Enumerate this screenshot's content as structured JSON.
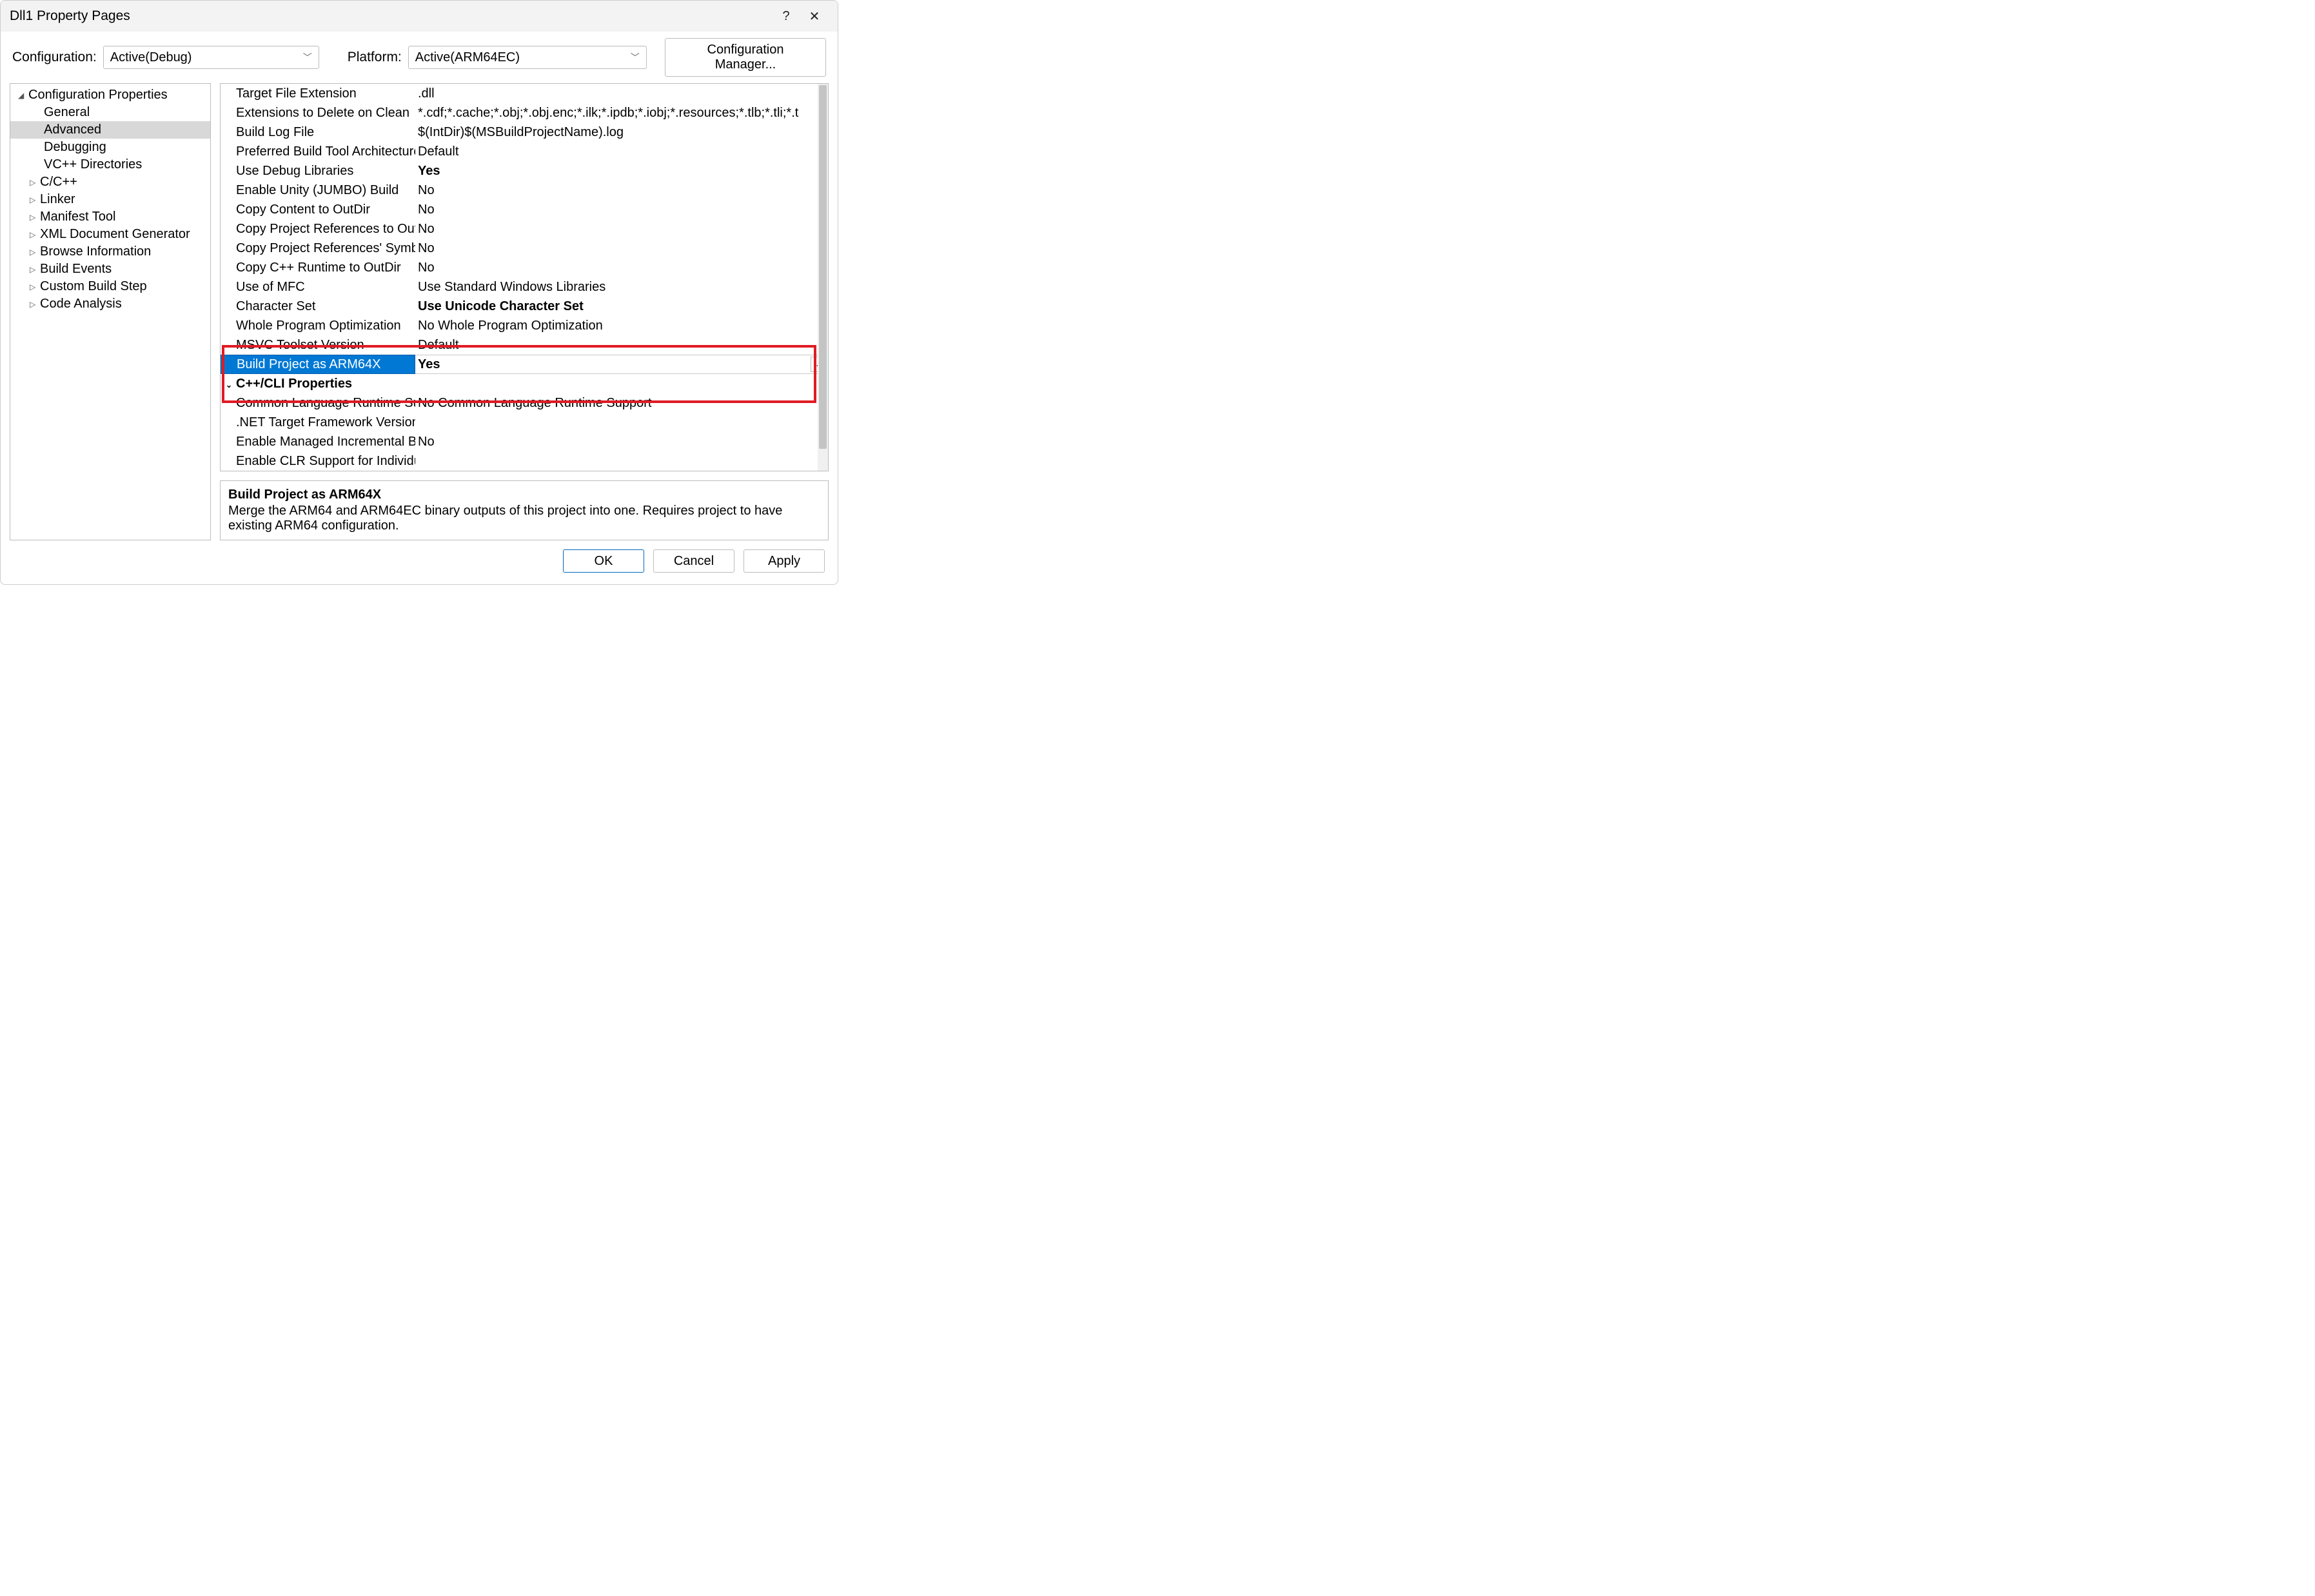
{
  "title": "Dll1 Property Pages",
  "toolbar": {
    "config_label": "Configuration:",
    "config_value": "Active(Debug)",
    "platform_label": "Platform:",
    "platform_value": "Active(ARM64EC)",
    "config_manager": "Configuration Manager..."
  },
  "tree": {
    "root": "Configuration Properties",
    "items": [
      {
        "label": "General",
        "expander": ""
      },
      {
        "label": "Advanced",
        "expander": "",
        "selected": true
      },
      {
        "label": "Debugging",
        "expander": ""
      },
      {
        "label": "VC++ Directories",
        "expander": ""
      },
      {
        "label": "C/C++",
        "expander": "▷"
      },
      {
        "label": "Linker",
        "expander": "▷"
      },
      {
        "label": "Manifest Tool",
        "expander": "▷"
      },
      {
        "label": "XML Document Generator",
        "expander": "▷"
      },
      {
        "label": "Browse Information",
        "expander": "▷"
      },
      {
        "label": "Build Events",
        "expander": "▷"
      },
      {
        "label": "Custom Build Step",
        "expander": "▷"
      },
      {
        "label": "Code Analysis",
        "expander": "▷"
      }
    ]
  },
  "grid": [
    {
      "k": "Target File Extension",
      "v": ".dll"
    },
    {
      "k": "Extensions to Delete on Clean",
      "v": "*.cdf;*.cache;*.obj;*.obj.enc;*.ilk;*.ipdb;*.iobj;*.resources;*.tlb;*.tli;*.t"
    },
    {
      "k": "Build Log File",
      "v": "$(IntDir)$(MSBuildProjectName).log"
    },
    {
      "k": "Preferred Build Tool Architecture",
      "v": "Default"
    },
    {
      "k": "Use Debug Libraries",
      "v": "Yes",
      "bold": true
    },
    {
      "k": "Enable Unity (JUMBO) Build",
      "v": "No"
    },
    {
      "k": "Copy Content to OutDir",
      "v": "No"
    },
    {
      "k": "Copy Project References to OutDi",
      "v": "No"
    },
    {
      "k": "Copy Project References' Symbols",
      "v": "No"
    },
    {
      "k": "Copy C++ Runtime to OutDir",
      "v": "No"
    },
    {
      "k": "Use of MFC",
      "v": "Use Standard Windows Libraries"
    },
    {
      "k": "Character Set",
      "v": "Use Unicode Character Set",
      "bold": true
    },
    {
      "k": "Whole Program Optimization",
      "v": "No Whole Program Optimization"
    },
    {
      "k": "MSVC Toolset Version",
      "v": "Default"
    },
    {
      "k": "Build Project as ARM64X",
      "v": "Yes",
      "selected": true
    },
    {
      "k": "C++/CLI Properties",
      "section": true
    },
    {
      "k": "Common Language Runtime Sup",
      "v": "No Common Language Runtime Support"
    },
    {
      "k": ".NET Target Framework Version",
      "v": ""
    },
    {
      "k": "Enable Managed Incremental Buil",
      "v": "No"
    },
    {
      "k": "Enable CLR Support for Individual",
      "v": ""
    }
  ],
  "description": {
    "title": "Build Project as ARM64X",
    "body": "Merge the ARM64 and ARM64EC binary outputs of this project into one. Requires project to have existing ARM64 configuration."
  },
  "buttons": {
    "ok": "OK",
    "cancel": "Cancel",
    "apply": "Apply"
  },
  "highlight": {
    "row_from": 13,
    "row_to": 15
  }
}
